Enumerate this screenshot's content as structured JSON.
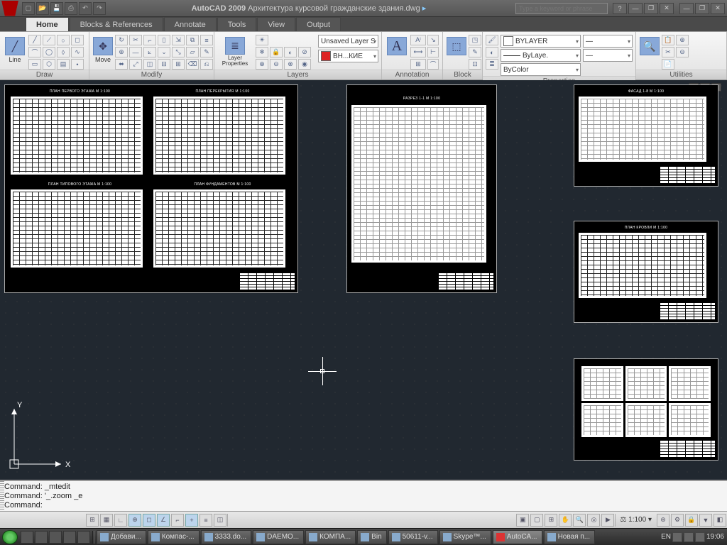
{
  "title": {
    "app": "AutoCAD 2009",
    "doc": "Архитектура курсовой гражданские здания.dwg"
  },
  "search_placeholder": "Type a keyword or phrase",
  "qat": [
    "new",
    "open",
    "save",
    "plot",
    "undo",
    "redo"
  ],
  "tabs": [
    "Home",
    "Blocks & References",
    "Annotate",
    "Tools",
    "View",
    "Output"
  ],
  "active_tab": 0,
  "ribbon": {
    "draw": {
      "title": "Draw",
      "big": "Line"
    },
    "modify": {
      "title": "Modify",
      "big": "Move"
    },
    "layers": {
      "title": "Layers",
      "big": "Layer\nProperties",
      "combo": "Unsaved Layer S",
      "layer": "ВН...КИЕ"
    },
    "annotation": {
      "title": "Annotation"
    },
    "block": {
      "title": "Block"
    },
    "properties": {
      "title": "Properties",
      "color": "BYLAYER",
      "lw": "ByLaye.",
      "lt": "ByColor"
    },
    "utilities": {
      "title": "Utilities"
    }
  },
  "cmd": {
    "l1": "Command: _mtedit",
    "l2": "Command: '_.zoom _e",
    "l3": "Command:"
  },
  "status": {
    "coords": "",
    "scale": "1:100",
    "lang": "EN",
    "time": "19:06"
  },
  "tasks": [
    "Добави...",
    "Компас-...",
    "3333.do...",
    "DAEMO...",
    "КОМПА...",
    "Bin",
    "50611-v...",
    "Skype™...",
    "AutoCA...",
    "Новая п..."
  ],
  "active_task": 8,
  "sheets": {
    "s1": {
      "t1": "ПЛАН ПЕРВОГО ЭТАЖА М 1:100",
      "t2": "ПЛАН ПЕРЕКРЫТИЯ М 1:100",
      "t3": "ПЛАН ТИПОВОГО ЭТАЖА М 1:100",
      "t4": "ПЛАН ФУНДАМЕНТОВ М 1:100"
    },
    "s2": {
      "t": "РАЗРЕЗ 1-1 М 1:100"
    },
    "s3": {
      "t": "ФАСАД 1-8 М 1:100"
    },
    "s4": {
      "t": "ПЛАН КРОВЛИ М 1:100"
    }
  }
}
